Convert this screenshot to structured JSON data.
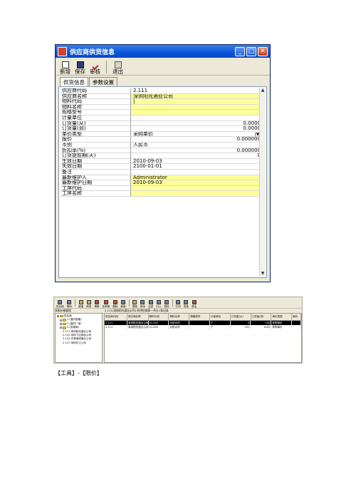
{
  "dialog": {
    "title": "供应商供货信息",
    "toolbar": [
      {
        "label": "新增",
        "icon": "new-doc-icon"
      },
      {
        "label": "保存",
        "icon": "save-disk-icon"
      },
      {
        "label": "审核",
        "icon": "check-mark-icon"
      },
      {
        "label": "退出",
        "icon": "exit-door-icon"
      }
    ],
    "tabs": [
      "供货信息",
      "参数设置"
    ],
    "fields": [
      {
        "label": "供应商代码",
        "value": "2.111"
      },
      {
        "label": "供应商名称",
        "value": "深圳阳光酒业公司"
      },
      {
        "label": "物料代码",
        "value": "|"
      },
      {
        "label": "物料名称",
        "value": ""
      },
      {
        "label": "规格型号",
        "value": ""
      },
      {
        "label": "计量单位",
        "value": ""
      },
      {
        "label": "订货量(从)",
        "value": "0.0000"
      },
      {
        "label": "订货量(到)",
        "value": "0.0000"
      },
      {
        "label": "单价类型",
        "value": "采购单价"
      },
      {
        "label": "报价",
        "value": "0.000000"
      },
      {
        "label": "币别",
        "value": "人民币"
      },
      {
        "label": "折扣率(%)",
        "value": "0.000000"
      },
      {
        "label": "订货提前期(天)",
        "value": "0"
      },
      {
        "label": "生效日期",
        "value": "2010-09-03"
      },
      {
        "label": "失效日期",
        "value": "2100-01-01"
      },
      {
        "label": "备注",
        "value": ""
      },
      {
        "label": "最新维护人",
        "value": "Administrator"
      },
      {
        "label": "最新维护日期",
        "value": "2010-09-03"
      },
      {
        "label": "工序代码",
        "value": ""
      },
      {
        "label": "工序名称",
        "value": ""
      }
    ]
  },
  "app2": {
    "toolbar": [
      "供应商",
      "物料",
      "新增",
      "修改",
      "审核",
      "反审核",
      "删除",
      "刷新",
      "搜索",
      "排序",
      "过滤",
      "引入",
      "预览",
      "打印",
      "查找",
      "退出"
    ],
    "left_header": "采购价格管理",
    "right_header": "2.111(深圳阳光酒业公司) 的供应商表一共计1条记录",
    "tree": [
      "供应商",
      "1 (国内配套)",
      "2 (国内厂家)",
      "3 (供销商)",
      "2.111 深圳阳光酒业公司",
      "2.122 深圳飞达食品公司",
      "2.124 天津海滨酒业公司",
      "2.127 深圳长江公司"
    ],
    "columns": [
      "供应商代码",
      "供应商名称",
      "物料代码",
      "物料名称",
      "规格型号",
      "计量单位",
      "订货量(从)",
      "订货量(到)",
      "单价类型",
      "报价"
    ],
    "rows": [
      [
        "2.111",
        "深圳阳光酒业公司",
        "01.002",
        "大桥水饺",
        "",
        "个",
        "0",
        "100",
        "采购单价",
        ""
      ],
      [
        "2.111",
        "深圳阳光酒业公司",
        "01.002",
        "大桥水饺",
        "",
        "个",
        "101",
        "1000",
        "采购单价",
        ""
      ]
    ]
  },
  "caption": "【工具】-【限价】"
}
